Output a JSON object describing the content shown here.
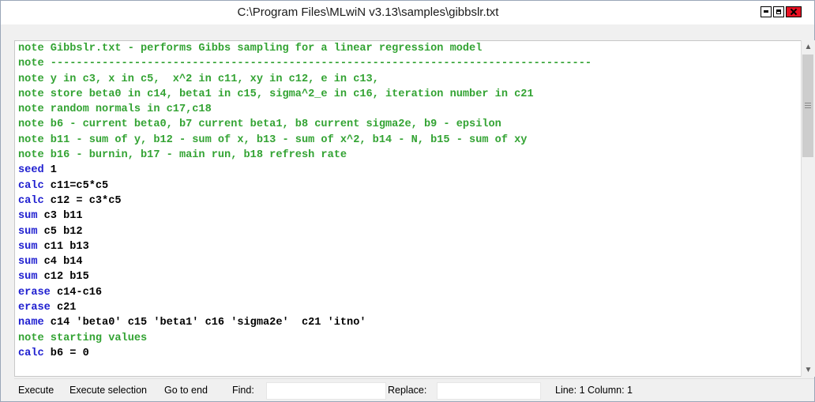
{
  "window": {
    "title": "C:\\Program Files\\MLwiN v3.13\\samples\\gibbslr.txt"
  },
  "editor": {
    "lines": [
      {
        "kw": "note",
        "rest": " Gibbslr.txt - performs Gibbs sampling for a linear regression model",
        "kind": "note"
      },
      {
        "kw": "note",
        "rest": " ------------------------------------------------------------------------------------",
        "kind": "note"
      },
      {
        "kw": "note",
        "rest": " y in c3, x in c5,  x^2 in c11, xy in c12, e in c13,",
        "kind": "note"
      },
      {
        "kw": "note",
        "rest": " store beta0 in c14, beta1 in c15, sigma^2_e in c16, iteration number in c21",
        "kind": "note"
      },
      {
        "kw": "note",
        "rest": " random normals in c17,c18",
        "kind": "note"
      },
      {
        "kw": "note",
        "rest": " b6 - current beta0, b7 current beta1, b8 current sigma2e, b9 - epsilon",
        "kind": "note"
      },
      {
        "kw": "note",
        "rest": " b11 - sum of y, b12 - sum of x, b13 - sum of x^2, b14 - N, b15 - sum of xy",
        "kind": "note"
      },
      {
        "kw": "note",
        "rest": " b16 - burnin, b17 - main run, b18 refresh rate",
        "kind": "note"
      },
      {
        "kw": "seed",
        "rest": " 1",
        "kind": "cmd"
      },
      {
        "kw": "calc",
        "rest": " c11=c5*c5",
        "kind": "cmd"
      },
      {
        "kw": "calc",
        "rest": " c12 = c3*c5",
        "kind": "cmd"
      },
      {
        "kw": "sum",
        "rest": " c3 b11",
        "kind": "cmd"
      },
      {
        "kw": "sum",
        "rest": " c5 b12",
        "kind": "cmd"
      },
      {
        "kw": "sum",
        "rest": " c11 b13",
        "kind": "cmd"
      },
      {
        "kw": "sum",
        "rest": " c4 b14",
        "kind": "cmd"
      },
      {
        "kw": "sum",
        "rest": " c12 b15",
        "kind": "cmd"
      },
      {
        "kw": "erase",
        "rest": " c14-c16",
        "kind": "cmd"
      },
      {
        "kw": "erase",
        "rest": " c21",
        "kind": "cmd"
      },
      {
        "kw": "name",
        "rest": " c14 'beta0' c15 'beta1' c16 'sigma2e'  c21 'itno'",
        "kind": "cmd"
      },
      {
        "kw": "note",
        "rest": " starting values",
        "kind": "note"
      },
      {
        "kw": "calc",
        "rest": " b6 = 0",
        "kind": "cmd"
      }
    ]
  },
  "statusbar": {
    "execute_label": "Execute",
    "execute_selection_label": "Execute selection",
    "go_to_end_label": "Go to end",
    "find_label": "Find:",
    "find_value": "",
    "replace_label": "Replace:",
    "replace_value": "",
    "cursor_position": "Line: 1 Column: 1"
  },
  "colors": {
    "note": "#33a333",
    "command": "#2020d0",
    "close_button": "#e81123"
  },
  "icons": {
    "minimize": "minimize-icon",
    "maximize": "maximize-icon",
    "close": "close-icon",
    "scroll_up": "chevron-up-icon",
    "scroll_down": "chevron-down-icon"
  }
}
